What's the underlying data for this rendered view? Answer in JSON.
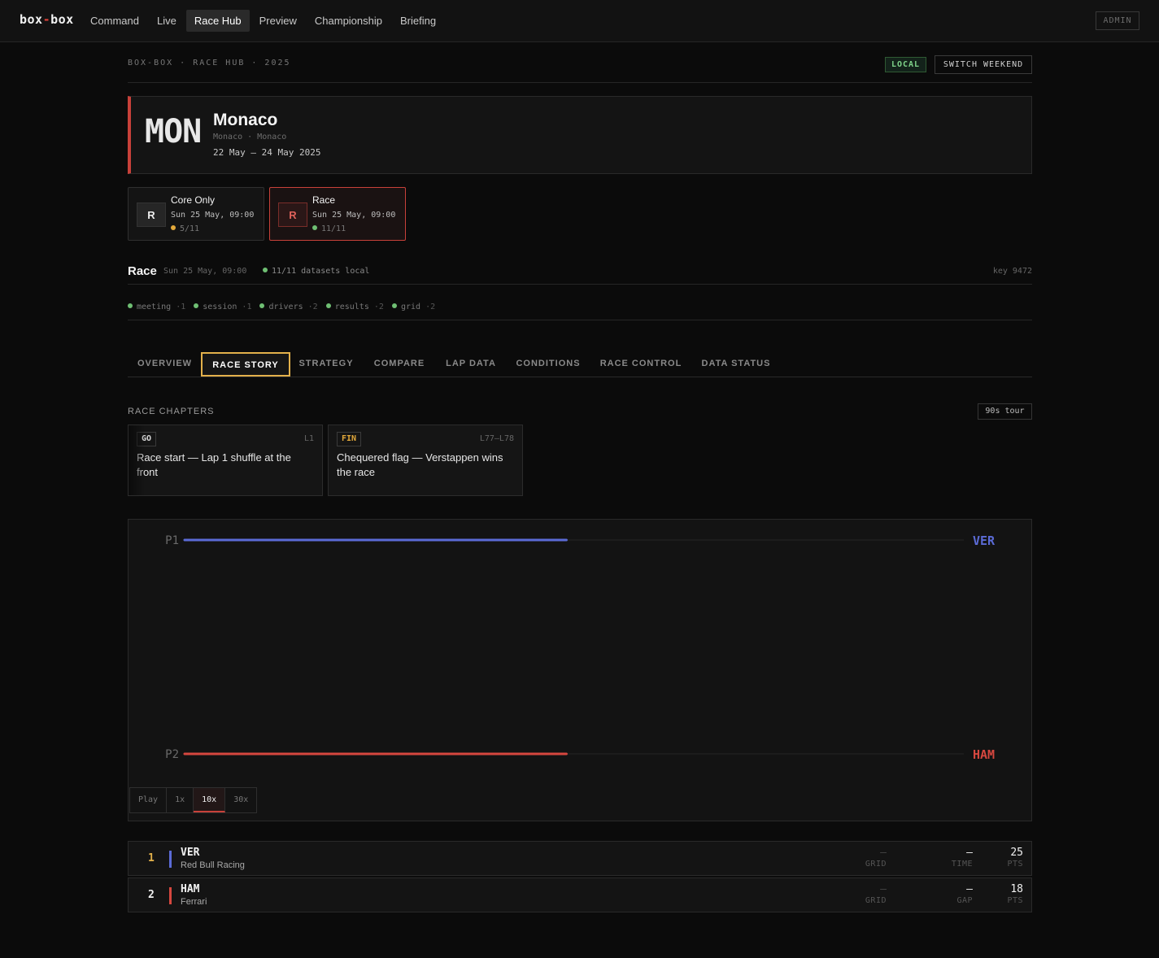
{
  "brand": {
    "left": "box",
    "sep": "-",
    "right": "box"
  },
  "nav": {
    "items": [
      "Command",
      "Live",
      "Race Hub",
      "Preview",
      "Championship",
      "Briefing"
    ],
    "active": "Race Hub",
    "admin_label": "ADMIN"
  },
  "header": {
    "breadcrumb": "BOX-BOX · RACE HUB · 2025",
    "local_badge": "LOCAL",
    "switch_label": "SWITCH WEEKEND"
  },
  "event": {
    "code": "MON",
    "name": "Monaco",
    "location": "Monaco · Monaco",
    "dates": "22 May – 24 May 2025"
  },
  "sessions": [
    {
      "icon": "R",
      "title": "Core Only",
      "time": "Sun 25 May, 09:00",
      "count": "5/11",
      "status_color": "#e3a93b",
      "active": false
    },
    {
      "icon": "R",
      "title": "Race",
      "time": "Sun 25 May, 09:00",
      "count": "11/11",
      "status_color": "#6fbf73",
      "active": true
    }
  ],
  "session_info": {
    "title": "Race",
    "datetime": "Sun 25 May, 09:00",
    "status": "11/11 datasets local",
    "key": "key 9472"
  },
  "datasets": [
    {
      "name": "meeting",
      "count": "·1"
    },
    {
      "name": "session",
      "count": "·1"
    },
    {
      "name": "drivers",
      "count": "·2"
    },
    {
      "name": "results",
      "count": "·2"
    },
    {
      "name": "grid",
      "count": "·2"
    }
  ],
  "tabs": [
    "OVERVIEW",
    "RACE STORY",
    "STRATEGY",
    "COMPARE",
    "LAP DATA",
    "CONDITIONS",
    "RACE CONTROL",
    "DATA STATUS"
  ],
  "active_tab": "RACE STORY",
  "chapters": {
    "title": "RACE CHAPTERS",
    "tour_label": "90s tour",
    "items": [
      {
        "tag": "GO",
        "laps": "L1",
        "text": "Race start — Lap 1 shuffle at the front",
        "tag_color": "#d9d9d9"
      },
      {
        "tag": "FIN",
        "laps": "L77–L78",
        "text": "Chequered flag — Verstappen wins the race",
        "tag_color": "#e3a93b"
      }
    ]
  },
  "chart_data": {
    "type": "line",
    "title": "",
    "y_categories": [
      "P1",
      "P2"
    ],
    "series": [
      {
        "name": "VER",
        "color": "#5b6bd6",
        "position": 1,
        "progress": 0.49
      },
      {
        "name": "HAM",
        "color": "#d6473f",
        "position": 2,
        "progress": 0.49
      }
    ]
  },
  "playback": {
    "buttons": [
      "Play",
      "1x",
      "10x",
      "30x"
    ],
    "active": "10x"
  },
  "results": [
    {
      "pos": "1",
      "code": "VER",
      "team": "Red Bull Racing",
      "color": "#5b6bd6",
      "pos_color": "#e3b14b",
      "grid": "–",
      "grid_label": "GRID",
      "time": "—",
      "time_label": "TIME",
      "pts": "25",
      "pts_label": "PTS"
    },
    {
      "pos": "2",
      "code": "HAM",
      "team": "Ferrari",
      "color": "#d6473f",
      "pos_color": "#f0f0f0",
      "grid": "–",
      "grid_label": "GRID",
      "time": "—",
      "time_label": "GAP",
      "pts": "18",
      "pts_label": "PTS"
    }
  ]
}
